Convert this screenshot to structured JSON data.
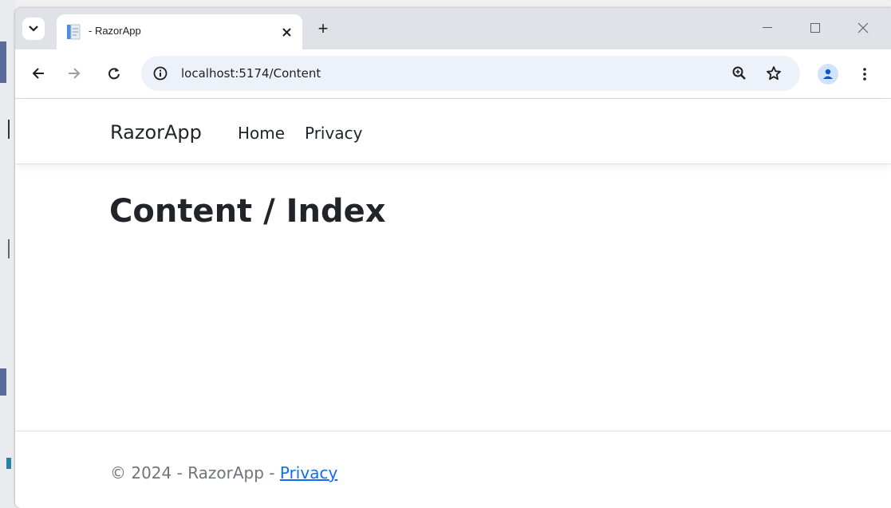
{
  "browser": {
    "tab": {
      "title": "- RazorApp"
    },
    "new_tab_label": "+",
    "address_bar": {
      "url": "localhost:5174/Content"
    },
    "icons": {
      "tab_search": "chevron-down-icon",
      "favicon": "page-icon",
      "tab_close": "close-icon",
      "back": "arrow-left-icon",
      "forward": "arrow-right-icon",
      "reload": "reload-icon",
      "site_info": "info-icon",
      "zoom": "zoom-icon",
      "bookmark": "star-icon",
      "profile": "person-icon",
      "menu": "more-vert-icon",
      "minimize": "minimize-icon",
      "maximize": "maximize-icon",
      "close_window": "close-icon"
    }
  },
  "site": {
    "brand": "RazorApp",
    "nav": {
      "home": "Home",
      "privacy": "Privacy"
    },
    "heading": "Content / Index",
    "footer": {
      "text": "© 2024 - RazorApp - ",
      "link": "Privacy"
    }
  },
  "colors": {
    "link": "#0d6efd",
    "text": "#212529",
    "muted": "#6c757d",
    "tabstrip": "#dfe3e8",
    "omnibox": "#edf2fa"
  }
}
